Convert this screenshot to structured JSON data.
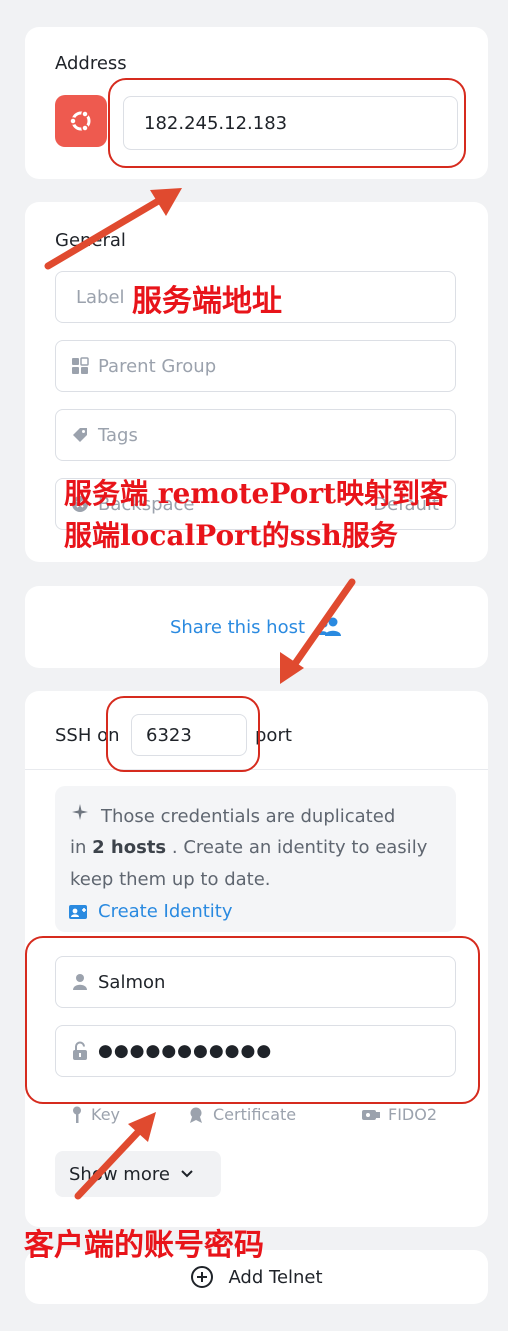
{
  "address": {
    "heading": "Address",
    "value": "182.245.12.183",
    "os_icon": "ubuntu-icon"
  },
  "general": {
    "heading": "General",
    "label_placeholder": "Label",
    "parent_group_placeholder": "Parent Group",
    "tags_placeholder": "Tags",
    "backspace_label": "Backspace",
    "backspace_value": "Default"
  },
  "share": {
    "label": "Share this host"
  },
  "ssh": {
    "prefix": "SSH on",
    "port": "6323",
    "suffix": "port",
    "notice_line1": "Those credentials are duplicated",
    "notice_in": "in ",
    "notice_hosts": "2 hosts",
    "notice_rest": " . Create an identity to easily",
    "notice_line3": "keep them up to date.",
    "create_identity": "Create Identity",
    "username": "Salmon",
    "password": "●●●●●●●●●●●",
    "key_label": "Key",
    "certificate_label": "Certificate",
    "fido_label": "FIDO2",
    "show_more": "Show more"
  },
  "add_telnet": {
    "label": "Add Telnet"
  },
  "annotations": {
    "server_address": "服务端地址",
    "port_mapping_line1": "服务端 remotePort映射到客",
    "port_mapping_line2": "服端localPort的ssh服务",
    "client_account": "客户端的账号密码"
  },
  "colors": {
    "accent": "#2a8ae0",
    "ubuntu": "#ee5a4f",
    "annotation": "#e8141a"
  }
}
